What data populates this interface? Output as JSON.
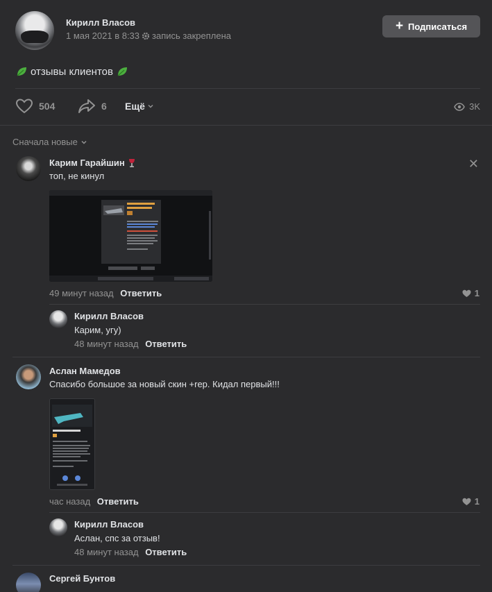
{
  "post": {
    "author": "Кирилл Власов",
    "date": "1 мая 2021 в 8:33",
    "pinned": "запись закреплена",
    "subscribe_label": "Подписаться",
    "text": "отзывы клиентов",
    "likes": "504",
    "shares": "6",
    "more_label": "Ещё",
    "views": "3K"
  },
  "comments_sort": "Сначала новые",
  "comments": [
    {
      "author": "Карим Гарайшин",
      "text": "топ, не кинул",
      "time": "49 минут назад",
      "reply_label": "Ответить",
      "likes": "1",
      "reply": {
        "author": "Кирилл Власов",
        "text": "Карим, угу)",
        "time": "48 минут назад",
        "reply_label": "Ответить"
      }
    },
    {
      "author": "Аслан Мамедов",
      "text": "Спасибо большое за новый скин +rep. Кидал первый!!!",
      "time": "час назад",
      "reply_label": "Ответить",
      "likes": "1",
      "reply": {
        "author": "Кирилл Власов",
        "text": "Аслан, спс за отзыв!",
        "time": "48 минут назад",
        "reply_label": "Ответить"
      }
    },
    {
      "author": "Сергей Бунтов"
    }
  ],
  "colors": {
    "background": "#2b2b2d",
    "text": "#e1e3e6",
    "secondary": "#939393",
    "button": "#545457"
  }
}
